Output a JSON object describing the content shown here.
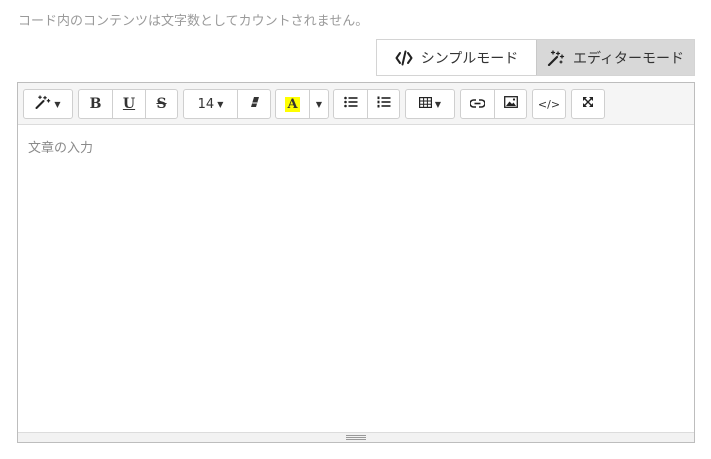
{
  "note": "コード内のコンテンツは文字数としてカウントされません。",
  "mode_switch": {
    "simple_label": "シンプルモード",
    "simple_icon": "code-icon",
    "editor_label": "エディターモード",
    "editor_icon": "magic-wand-icon",
    "active": "editor"
  },
  "toolbar": {
    "style_icon": "magic-wand-icon",
    "bold_label": "B",
    "underline_label": "U",
    "strike_label": "S",
    "font_size": "14",
    "eraser_icon": "eraser-icon",
    "highlight_label": "A",
    "highlight_color": "#ffff00",
    "unordered_list_icon": "unordered-list-icon",
    "ordered_list_icon": "ordered-list-icon",
    "table_icon": "table-icon",
    "link_icon": "link-icon",
    "image_icon": "image-icon",
    "codeview_label": "</>",
    "fullscreen_icon": "fullscreen-icon"
  },
  "editor": {
    "placeholder": "文章の入力"
  }
}
